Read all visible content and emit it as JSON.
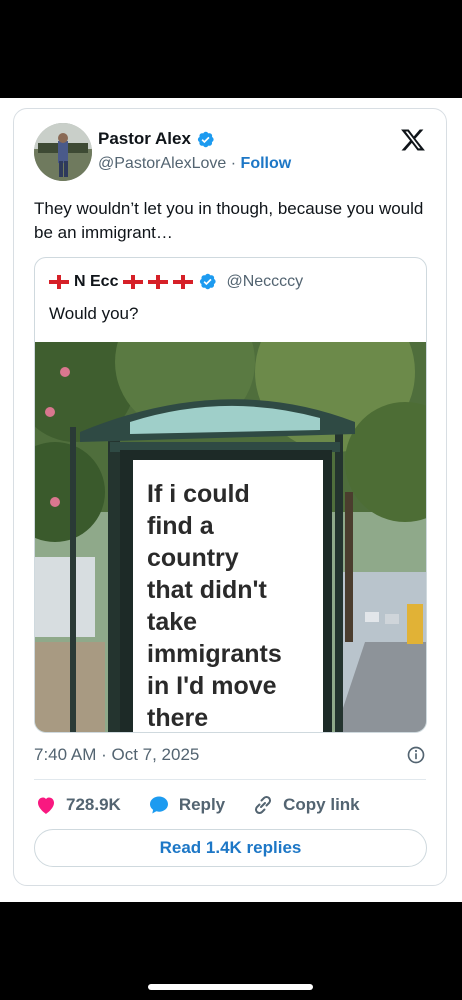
{
  "post": {
    "author_name": "Pastor Alex",
    "author_handle": "@PastorAlexLove",
    "separator": "·",
    "follow_label": "Follow",
    "text": "They wouldn’t let you in though, because you would be an immigrant…",
    "timestamp": "7:40 AM · Oct 7, 2025",
    "likes": "728.9K",
    "reply_label": "Reply",
    "copy_link_label": "Copy link",
    "read_replies_label": "Read 1.4K replies"
  },
  "quote": {
    "author_name": "N Ecc",
    "author_handle": "@Neccccy",
    "text": "Would you?",
    "image_text": "If i could\nfind a\ncountry\nthat didn't\ntake\nimmigrants\nin I'd move\nthere"
  },
  "icons": {
    "verified": "verified-badge-icon",
    "x_logo": "x-logo-icon",
    "info": "info-icon",
    "like": "heart-icon",
    "reply": "speech-bubble-icon",
    "copy_link": "link-icon",
    "flag": "england-flag-icon"
  },
  "colors": {
    "accent": "#1d77c6",
    "like": "#f91880",
    "flag_red": "#d62028"
  }
}
